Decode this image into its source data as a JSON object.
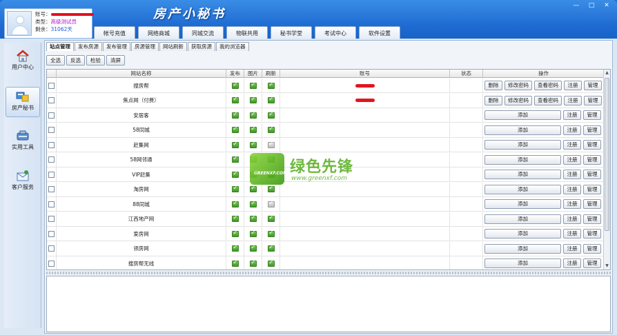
{
  "app": {
    "title": "房产小秘书"
  },
  "window_buttons": [
    "—",
    "□",
    "✕"
  ],
  "profile": {
    "account_label": "账号：",
    "type_label": "类型：",
    "type_value": "高级测试员",
    "remaining_label": "剩余：",
    "remaining_value": "31062天"
  },
  "top_tabs": [
    "帐号充值",
    "网络商城",
    "同城交流",
    "物联共用",
    "秘书学堂",
    "考试中心",
    "软件设置"
  ],
  "sidebar": [
    {
      "label": "用户中心",
      "icon": "home-icon"
    },
    {
      "label": "房产秘书",
      "icon": "secretary-icon",
      "active": true
    },
    {
      "label": "实用工具",
      "icon": "tools-icon"
    },
    {
      "label": "客户服务",
      "icon": "customer-service-icon"
    }
  ],
  "sub_tabs": [
    "站点管理",
    "发布房源",
    "发布管理",
    "房源管理",
    "网站刷新",
    "获取房源",
    "我的浏览器"
  ],
  "toolbar": [
    "全选",
    "反选",
    "检验",
    "清屏"
  ],
  "table": {
    "headers": [
      "网站名称",
      "发布",
      "图片",
      "刷新",
      "账号",
      "状态",
      "操作"
    ],
    "rows": [
      {
        "name": "搜房帮",
        "pub": true,
        "img": true,
        "ref": true,
        "acct_hidden": true,
        "registered": true
      },
      {
        "name": "焦点网（付费）",
        "pub": true,
        "img": true,
        "ref": true,
        "acct_hidden": true,
        "registered": true
      },
      {
        "name": "安居客",
        "pub": true,
        "img": true,
        "ref": true,
        "acct_hidden": false,
        "registered": false
      },
      {
        "name": "58同城",
        "pub": true,
        "img": true,
        "ref": true,
        "acct_hidden": false,
        "registered": false
      },
      {
        "name": "赶集网",
        "pub": true,
        "img": true,
        "ref": false,
        "acct_hidden": false,
        "registered": false
      },
      {
        "name": "58网邻通",
        "pub": true,
        "img": true,
        "ref": true,
        "acct_hidden": false,
        "registered": false
      },
      {
        "name": "VIP赶集",
        "pub": true,
        "img": true,
        "ref": true,
        "acct_hidden": false,
        "registered": false
      },
      {
        "name": "淘房网",
        "pub": true,
        "img": true,
        "ref": true,
        "acct_hidden": false,
        "registered": false
      },
      {
        "name": "88同城",
        "pub": true,
        "img": true,
        "ref": false,
        "acct_hidden": false,
        "registered": false
      },
      {
        "name": "江西地产网",
        "pub": true,
        "img": true,
        "ref": true,
        "acct_hidden": false,
        "registered": false
      },
      {
        "name": "爱房网",
        "pub": true,
        "img": true,
        "ref": true,
        "acct_hidden": false,
        "registered": false
      },
      {
        "name": "领房网",
        "pub": true,
        "img": true,
        "ref": true,
        "acct_hidden": false,
        "registered": false
      },
      {
        "name": "搜房帮无线",
        "pub": true,
        "img": true,
        "ref": true,
        "acct_hidden": false,
        "registered": false
      }
    ],
    "ops": {
      "delete": "删除",
      "change_pwd": "修改密码",
      "view_pwd": "查看密码",
      "add": "添加",
      "register": "注册",
      "manage": "管理"
    }
  },
  "watermark": {
    "cn": "绿色先锋",
    "url": "www.greenxf.com",
    "logo_text": "GREENXF.COM"
  }
}
